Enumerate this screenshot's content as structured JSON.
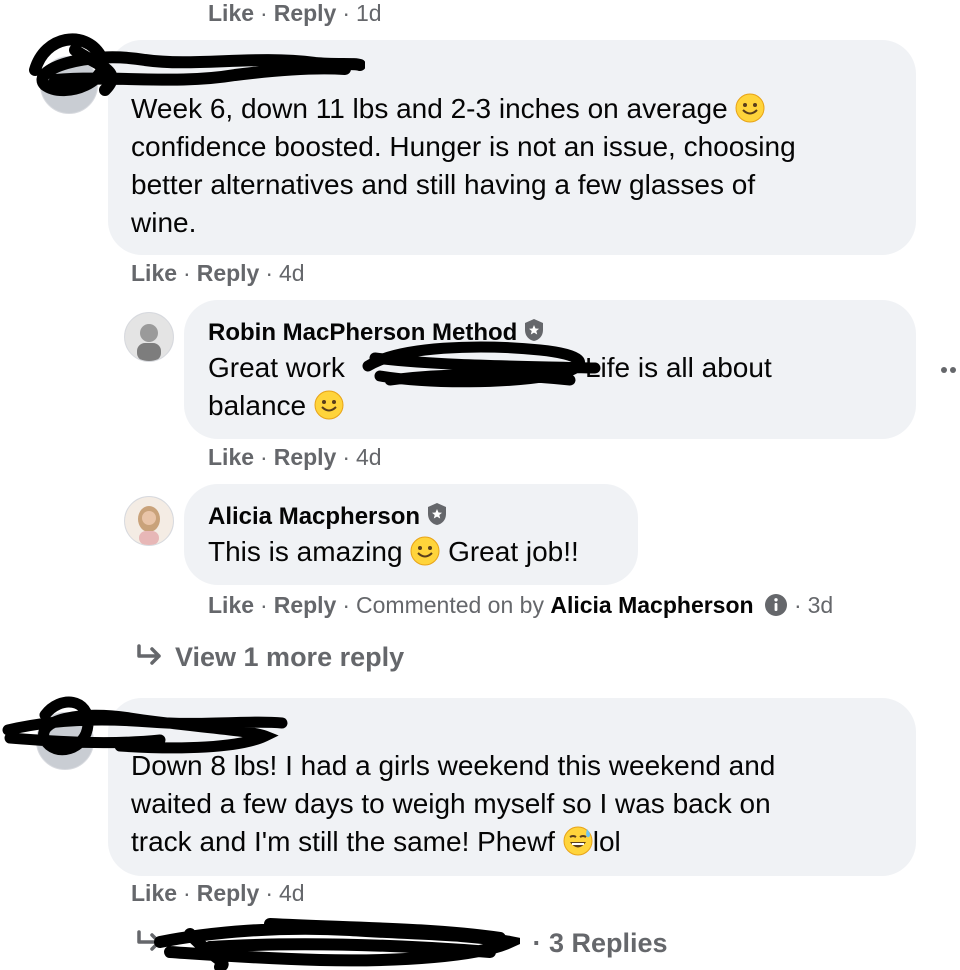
{
  "comments": [
    {
      "top_actions": {
        "like": "Like",
        "reply": "Reply",
        "time": "1d"
      }
    },
    {
      "text_lines": [
        "Week 6, down 11 lbs and 2-3 inches on average",
        "confidence boosted. Hunger is not an issue, choosing",
        "better alternatives and still having a few glasses of",
        "wine."
      ],
      "actions": {
        "like": "Like",
        "reply": "Reply",
        "time": "4d"
      }
    }
  ],
  "replies": [
    {
      "author": "Robin MacPherson Method",
      "text_part1": "Great work",
      "text_part2": "Life is all about",
      "text_line2": "balance",
      "actions": {
        "like": "Like",
        "reply": "Reply",
        "time": "4d"
      }
    },
    {
      "author": "Alicia Macpherson",
      "text_part1": "This is amazing",
      "text_part2": "Great job!!",
      "actions": {
        "like": "Like",
        "reply": "Reply",
        "commented_on_by": "Commented on by",
        "commenter": "Alicia Macpherson",
        "time": "3d"
      }
    }
  ],
  "view_more": "View 1 more reply",
  "comment2": {
    "text_lines": [
      "Down 8 lbs! I had a girls weekend this weekend and",
      "waited a few days to weigh myself so I was back on",
      "track and I'm still the same! Phewf"
    ],
    "suffix": "lol",
    "actions": {
      "like": "Like",
      "reply": "Reply",
      "time": "4d"
    }
  },
  "replies_summary": "· 3 Replies",
  "icons": [
    "shield-icon",
    "smile-emoji-icon",
    "sweat-smile-emoji-icon",
    "info-icon",
    "reply-arrow-icon",
    "more-icon"
  ],
  "colors": {
    "bubble": "#f0f2f5",
    "meta": "#65676b",
    "text": "#050505",
    "scribble": "#000000"
  }
}
